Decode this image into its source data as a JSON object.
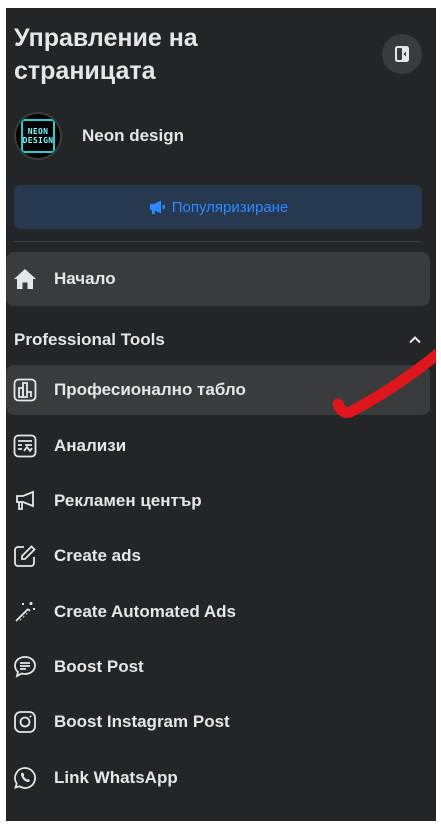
{
  "header": {
    "title": "Управление на страницата"
  },
  "profile": {
    "name": "Neon design",
    "avatar_text_line1": "NEON",
    "avatar_text_line2": "DESIGN"
  },
  "promote": {
    "label": "Популяризиране"
  },
  "nav": {
    "home": {
      "label": "Начало",
      "icon": "home-icon"
    }
  },
  "professional_tools": {
    "title": "Professional Tools",
    "items": [
      {
        "label": "Професионално табло",
        "icon": "dashboard-icon",
        "active": true
      },
      {
        "label": "Анализи",
        "icon": "insights-icon"
      },
      {
        "label": "Рекламен център",
        "icon": "megaphone-icon"
      },
      {
        "label": "Create ads",
        "icon": "edit-icon"
      },
      {
        "label": "Create Automated Ads",
        "icon": "magic-wand-icon"
      },
      {
        "label": "Boost Post",
        "icon": "chat-icon"
      },
      {
        "label": "Boost Instagram Post",
        "icon": "instagram-icon"
      },
      {
        "label": "Link WhatsApp",
        "icon": "whatsapp-icon"
      }
    ]
  },
  "colors": {
    "background": "#242526",
    "hover": "#3a3b3c",
    "text": "#e4e6eb",
    "accent": "#2d88ff",
    "promote_bg": "#263951",
    "annotation": "#e0161d"
  }
}
